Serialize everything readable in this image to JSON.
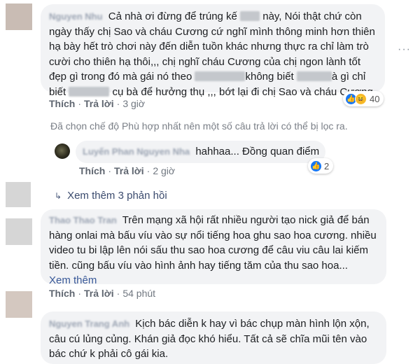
{
  "comments": [
    {
      "author": "Nguyen Nhu",
      "text_lines": [
        [
          "Cả nhà ơi đừng để trúng kế ",
          "[redacted]",
          " này, Nói thật chứ còn"
        ],
        [
          "ngày thấy chị Sao và cháu Cương cứ nghĩ mình thông minh hơn thiên"
        ],
        [
          "hạ bày hết trò chơi này đến diễn tuồn khác nhưng thực ra chỉ làm trò"
        ],
        [
          "cười cho thiên hạ thôi,,, chị nghĩ cháu Cương của chị ngon lành tốt"
        ],
        [
          "đẹp gì trong đó mà gái nó theo ",
          "[redacted]",
          "không biết ",
          "[redacted]",
          "à gì chỉ"
        ],
        [
          "biết ",
          "[redacted]",
          " cụ bà để hưởng thụ ,,, bớt lại đi chị Sao và cháu Cương"
        ]
      ],
      "actions": {
        "like": "Thích",
        "reply": "Trả lời",
        "time": "3 giờ"
      },
      "reactions": {
        "icons": [
          "like-icon",
          "haha-icon"
        ],
        "count": "40"
      }
    }
  ],
  "filter_notice": "Đã chọn chế độ Phù hợp nhất nên một số câu trả lời có thể bị lọc ra.",
  "reply": {
    "author": "Luyến Phan Nguyen Nha",
    "text": "hahhaa... Đồng quan điểm",
    "actions": {
      "like": "Thích",
      "reply": "Trả lời",
      "time": "2 giờ"
    },
    "reactions": {
      "icons": [
        "like-icon"
      ],
      "count": "2"
    }
  },
  "more_replies": {
    "label": "Xem thêm 3 phản hồi"
  },
  "comment2": {
    "author": "Thao Thao Tran",
    "lines": [
      "Trên mạng xã hội rất nhiều người tạo nick giả để bán",
      "hàng onlai mà bấu víu vào sự nổi tiếng hoa ghu sao hoa cương. nhiều",
      "video tu bi lập lên nói sấu thu sao hoa cương để câu viu câu lai kiếm",
      "tiền. cũng bấu víu vào hình ảnh hay tiếng tăm của thu sao hoa..."
    ],
    "see_more": "Xem thêm",
    "actions": {
      "like": "Thích",
      "reply": "Trả lời",
      "time": "54 phút"
    }
  },
  "comment3": {
    "author": "Nguyen Trang Anh",
    "lines": [
      "Kịch bác diễn k hay vì bác chụp màn hình lộn xộn,",
      "câu cú lủng củng. Khán giả đọc khó hiểu. Tất cả sẽ chĩa mũi tên vào",
      "bác chứ k phải cô gái kia."
    ]
  },
  "options_icon": "more-options-icon",
  "colors": {
    "bubble": "#f2f3f5",
    "link": "#385898",
    "like_blue": "#1877f2",
    "haha_yellow": "#f7b928"
  }
}
